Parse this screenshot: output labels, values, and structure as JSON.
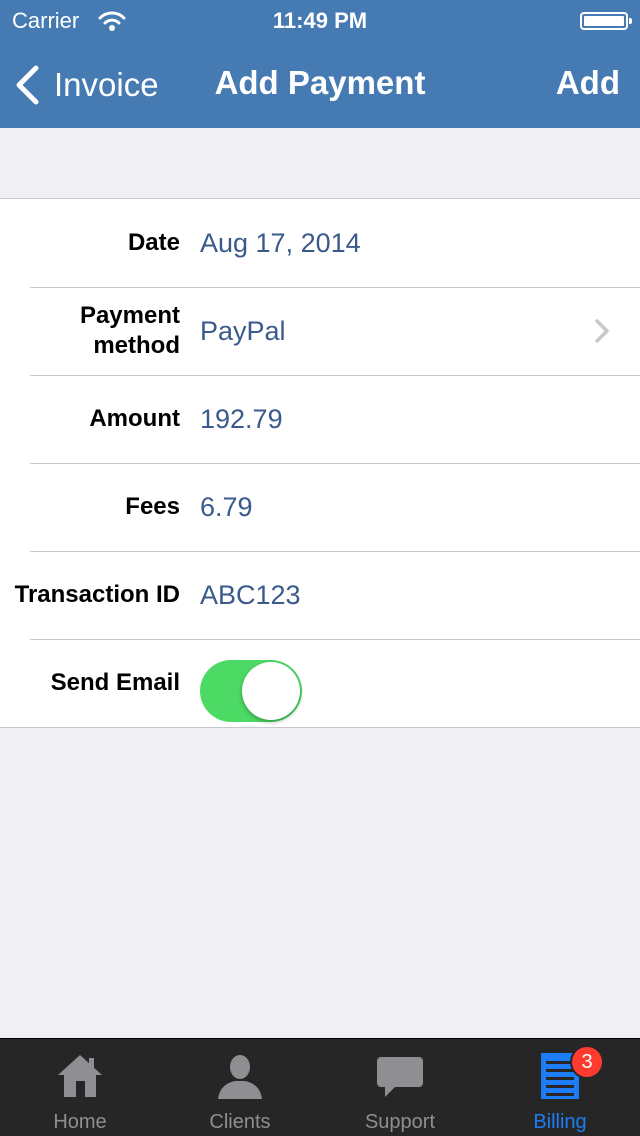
{
  "status_bar": {
    "carrier": "Carrier",
    "time": "11:49 PM"
  },
  "nav": {
    "back_label": "Invoice",
    "title": "Add Payment",
    "action_label": "Add"
  },
  "form": {
    "date_label": "Date",
    "date_value": "Aug 17, 2014",
    "method_label_line1": "Payment",
    "method_label_line2": "method",
    "method_value": "PayPal",
    "amount_label": "Amount",
    "amount_value": "192.79",
    "fees_label": "Fees",
    "fees_value": "6.79",
    "transaction_label": "Transaction ID",
    "transaction_value": "ABC123",
    "send_email_label": "Send Email",
    "send_email_on": true
  },
  "tabbar": {
    "items": [
      {
        "label": "Home",
        "icon": "home-icon"
      },
      {
        "label": "Clients",
        "icon": "person-icon"
      },
      {
        "label": "Support",
        "icon": "chat-bubble-icon"
      },
      {
        "label": "Billing",
        "icon": "document-icon",
        "badge": "3",
        "active": true
      }
    ]
  },
  "colors": {
    "nav_bar": "#457ab2",
    "value_text": "#3b5a8c",
    "toggle_on": "#4cd964",
    "tab_active": "#1c7df5",
    "badge": "#ff3b30"
  }
}
